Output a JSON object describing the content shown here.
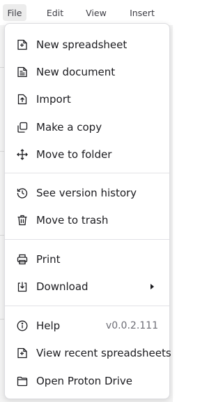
{
  "menubar": {
    "tabs": [
      {
        "label": "File"
      },
      {
        "label": "Edit"
      },
      {
        "label": "View"
      },
      {
        "label": "Insert"
      }
    ]
  },
  "file_menu": {
    "new_spreadsheet": "New spreadsheet",
    "new_document": "New document",
    "import": "Import",
    "make_a_copy": "Make a copy",
    "move_to_folder": "Move to folder",
    "see_version_history": "See version history",
    "move_to_trash": "Move to trash",
    "print": "Print",
    "download": "Download",
    "help": "Help",
    "version": "v0.0.2.111",
    "view_recent_spreadsheets": "View recent spreadsheets",
    "open_proton_drive": "Open Proton Drive"
  }
}
